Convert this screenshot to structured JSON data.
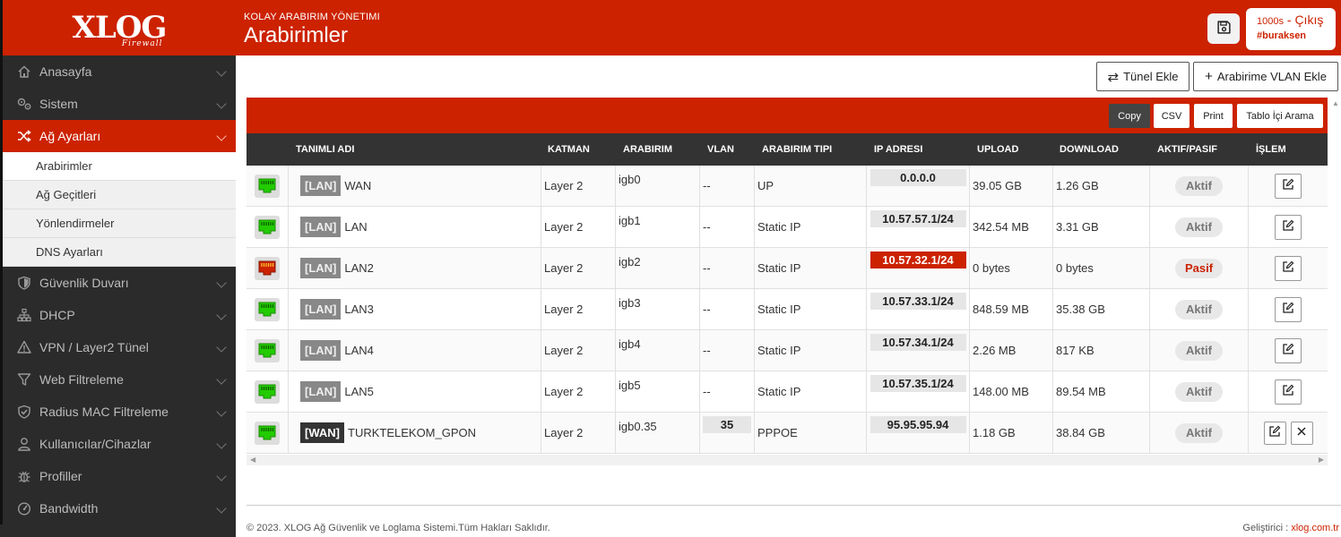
{
  "sidebar": {
    "logo": {
      "main": "XLOG",
      "sub": "Firewall"
    },
    "items": [
      {
        "label": "Anasayfa",
        "icon": "home-icon"
      },
      {
        "label": "Sistem",
        "icon": "gears-icon"
      },
      {
        "label": "Ağ Ayarları",
        "icon": "shuffle-icon",
        "active": true
      },
      {
        "label": "Güvenlik Duvarı",
        "icon": "shield-icon"
      },
      {
        "label": "DHCP",
        "icon": "sitemap-icon"
      },
      {
        "label": "VPN / Layer2 Tünel",
        "icon": "warning-icon"
      },
      {
        "label": "Web Filtreleme",
        "icon": "filter-icon"
      },
      {
        "label": "Radius MAC Filtreleme",
        "icon": "shield-check-icon"
      },
      {
        "label": "Kullanıcılar/Cihazlar",
        "icon": "user-icon"
      },
      {
        "label": "Profiller",
        "icon": "bug-icon"
      },
      {
        "label": "Bandwidth",
        "icon": "gauge-icon"
      }
    ],
    "subitems": [
      "Arabirimler",
      "Ağ Geçitleri",
      "Yönlendirmeler",
      "DNS Ayarları"
    ]
  },
  "header": {
    "breadcrumb": "KOLAY ARABIRIM YÖNETIMI",
    "title": "Arabirimler",
    "session_time": "1000s",
    "separator": " - ",
    "logout_label": "Çıkış",
    "username": "#buraksen"
  },
  "actions": {
    "tunnel_label": "Tünel Ekle",
    "vlan_label": "Arabirime VLAN Ekle"
  },
  "table_toolbar": {
    "copy": "Copy",
    "csv": "CSV",
    "print": "Print",
    "search": "Tablo İçi Arama"
  },
  "table": {
    "columns": [
      "TANIMLI ADI",
      "KATMAN",
      "ARABIRIM",
      "VLAN",
      "ARABIRIM TIPI",
      "IP ADRESI",
      "UPLOAD",
      "DOWNLOAD",
      "AKTIF/PASIF",
      "İŞLEM"
    ],
    "rows": [
      {
        "tag": "[LAN]",
        "name": "WAN",
        "layer": "Layer 2",
        "iface": "igb0",
        "vlan": "--",
        "type": "UP",
        "ip": "0.0.0.0",
        "upload": "39.05 GB",
        "download": "1.26 GB",
        "status": "Aktif"
      },
      {
        "tag": "[LAN]",
        "name": "LAN",
        "layer": "Layer 2",
        "iface": "igb1",
        "vlan": "--",
        "type": "Static IP",
        "ip": "10.57.57.1/24",
        "upload": "342.54 MB",
        "download": "3.31 GB",
        "status": "Aktif"
      },
      {
        "tag": "[LAN]",
        "name": "LAN2",
        "layer": "Layer 2",
        "iface": "igb2",
        "vlan": "--",
        "type": "Static IP",
        "ip": "10.57.32.1/24",
        "upload": "0 bytes",
        "download": "0 bytes",
        "status": "Pasif"
      },
      {
        "tag": "[LAN]",
        "name": "LAN3",
        "layer": "Layer 2",
        "iface": "igb3",
        "vlan": "--",
        "type": "Static IP",
        "ip": "10.57.33.1/24",
        "upload": "848.59 MB",
        "download": "35.38 GB",
        "status": "Aktif"
      },
      {
        "tag": "[LAN]",
        "name": "LAN4",
        "layer": "Layer 2",
        "iface": "igb4",
        "vlan": "--",
        "type": "Static IP",
        "ip": "10.57.34.1/24",
        "upload": "2.26 MB",
        "download": "817 KB",
        "status": "Aktif"
      },
      {
        "tag": "[LAN]",
        "name": "LAN5",
        "layer": "Layer 2",
        "iface": "igb5",
        "vlan": "--",
        "type": "Static IP",
        "ip": "10.57.35.1/24",
        "upload": "148.00 MB",
        "download": "89.54 MB",
        "status": "Aktif"
      },
      {
        "tag": "[WAN]",
        "name": "TURKTELEKOM_GPON",
        "layer": "Layer 2",
        "iface": "igb0.35",
        "vlan": "35",
        "type": "PPPOE",
        "ip": "95.95.95.94",
        "upload": "1.18 GB",
        "download": "38.84 GB",
        "status": "Aktif"
      }
    ]
  },
  "footer": {
    "copyright": "© 2023. XLOG Ağ Güvenlik ve Loglama Sistemi.Tüm Hakları Saklıdır.",
    "dev_label": "Geliştirici : ",
    "dev_link": "xlog.com.tr"
  },
  "colors": {
    "brand": "#cc2200",
    "sidebar": "#2b2b2b",
    "port_up": "#22cc00",
    "port_down": "#cc2200"
  }
}
